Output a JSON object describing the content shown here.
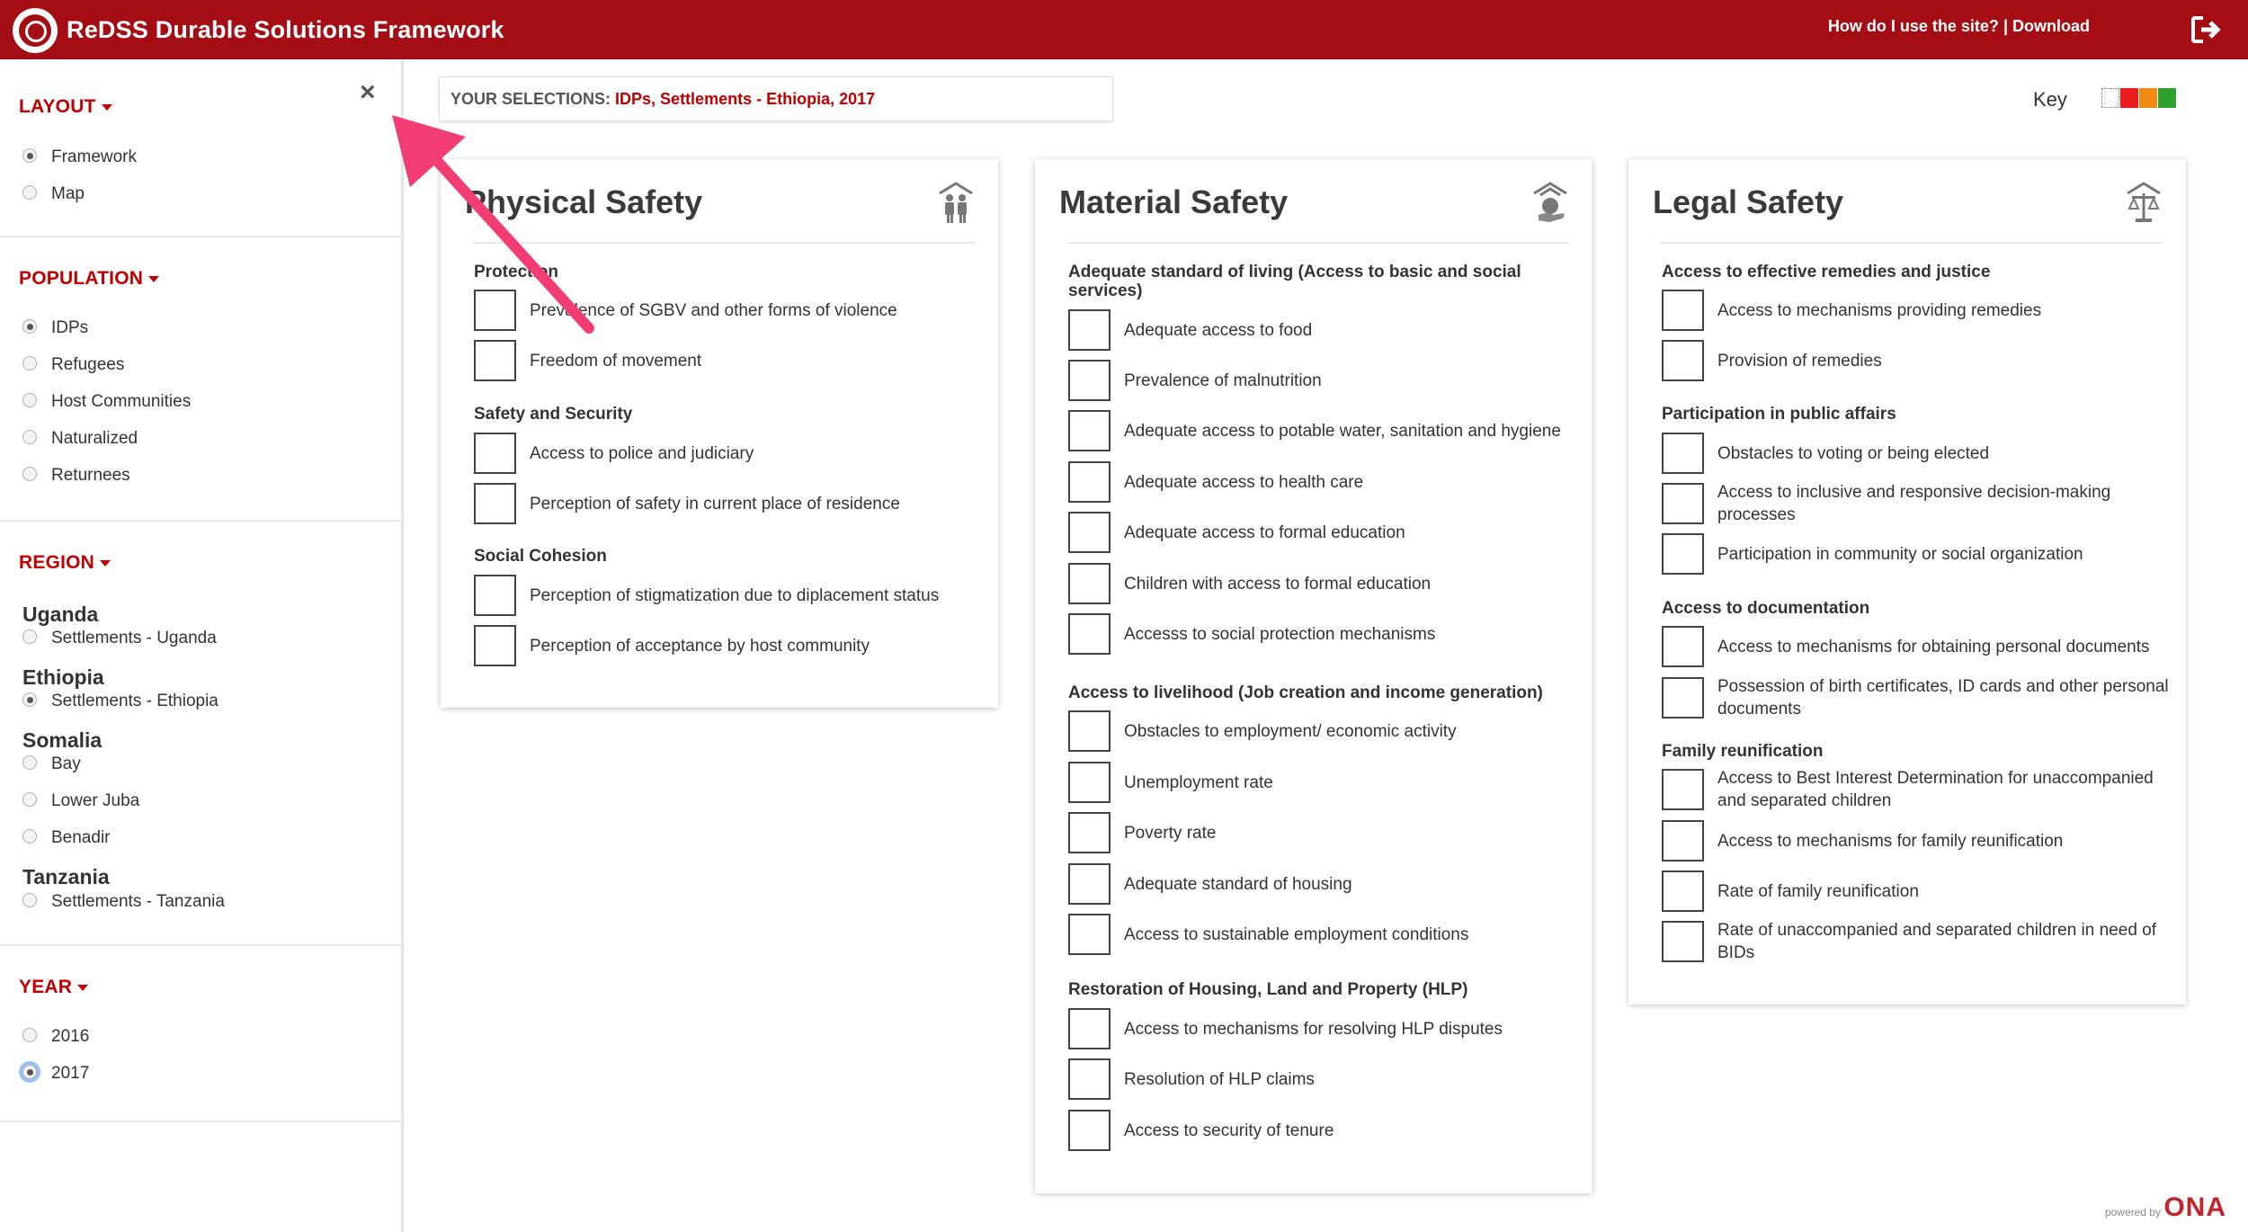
{
  "header": {
    "title": "ReDSS Durable Solutions Framework",
    "help_link": "How do I use the site?",
    "separator": "|",
    "download_link": "Download",
    "logout_icon": "logout-icon"
  },
  "sidebar": {
    "close_icon": "×",
    "layout": {
      "title": "LAYOUT",
      "options": [
        {
          "label": "Framework",
          "selected": true
        },
        {
          "label": "Map",
          "selected": false
        }
      ]
    },
    "population": {
      "title": "POPULATION",
      "options": [
        {
          "label": "IDPs",
          "selected": true
        },
        {
          "label": "Refugees",
          "selected": false
        },
        {
          "label": "Host Communities",
          "selected": false
        },
        {
          "label": "Naturalized",
          "selected": false
        },
        {
          "label": "Returnees",
          "selected": false
        }
      ]
    },
    "region": {
      "title": "REGION",
      "groups": [
        {
          "name": "Uganda",
          "options": [
            {
              "label": "Settlements - Uganda",
              "selected": false
            }
          ]
        },
        {
          "name": "Ethiopia",
          "options": [
            {
              "label": "Settlements - Ethiopia",
              "selected": true
            }
          ]
        },
        {
          "name": "Somalia",
          "options": [
            {
              "label": "Bay",
              "selected": false
            },
            {
              "label": "Lower Juba",
              "selected": false
            },
            {
              "label": "Benadir",
              "selected": false
            }
          ]
        },
        {
          "name": "Tanzania",
          "options": [
            {
              "label": "Settlements - Tanzania",
              "selected": false
            }
          ]
        }
      ]
    },
    "year": {
      "title": "YEAR",
      "options": [
        {
          "label": "2016",
          "selected": false
        },
        {
          "label": "2017",
          "selected": true
        }
      ]
    }
  },
  "selections": {
    "label": "YOUR SELECTIONS:",
    "value": "IDPs, Settlements - Ethiopia, 2017"
  },
  "key": {
    "label": "Key",
    "colors": [
      "#ffffff",
      "#e81c1c",
      "#f08a10",
      "#2ea12e"
    ]
  },
  "cards": [
    {
      "title": "Physical Safety",
      "icon": "family-icon",
      "groups": [
        {
          "name": "Protection",
          "items": [
            "Prevalence of SGBV and other forms of violence",
            "Freedom of movement"
          ]
        },
        {
          "name": "Safety and Security",
          "items": [
            "Access to police and judiciary",
            "Perception of safety in current place of residence"
          ]
        },
        {
          "name": "Social Cohesion",
          "items": [
            "Perception of stigmatization due to diplacement status",
            "Perception of acceptance by host community"
          ]
        }
      ]
    },
    {
      "title": "Material Safety",
      "icon": "shelter-hand-icon",
      "groups": [
        {
          "name": "Adequate standard of living (Access to basic and social services)",
          "items": [
            "Adequate access to food",
            "Prevalence of malnutrition",
            "Adequate access to potable water, sanitation and hygiene",
            "Adequate access to health care",
            "Adequate access to formal education",
            "Children with access to formal education",
            "Accesss to social protection mechanisms"
          ]
        },
        {
          "name": "Access to livelihood (Job creation and income generation)",
          "items": [
            "Obstacles to employment/ economic activity",
            "Unemployment rate",
            "Poverty rate",
            "Adequate standard of housing",
            "Access to sustainable employment conditions"
          ]
        },
        {
          "name": "Restoration of Housing, Land and Property (HLP)",
          "items": [
            "Access to mechanisms for resolving HLP disputes",
            "Resolution of HLP claims",
            "Access to security of tenure"
          ]
        }
      ]
    },
    {
      "title": "Legal Safety",
      "icon": "scales-icon",
      "groups": [
        {
          "name": "Access to effective remedies and justice",
          "items": [
            "Access to mechanisms providing remedies",
            "Provision of remedies"
          ]
        },
        {
          "name": "Participation in public affairs",
          "items": [
            "Obstacles to voting or being elected",
            "Access to inclusive and responsive decision-making processes",
            "Participation in community or social organization"
          ]
        },
        {
          "name": "Access to documentation",
          "items": [
            "Access to mechanisms for obtaining personal documents",
            "Possession of birth certificates, ID cards and other personal documents"
          ]
        },
        {
          "name": "Family reunification",
          "items": [
            "Access to Best Interest Determination for unaccompanied and separated children",
            "Access to mechanisms for family reunification",
            "Rate of family reunification",
            "Rate of unaccompanied and separated children in need of BIDs"
          ]
        }
      ]
    }
  ],
  "footer": {
    "powered_by": "powered by",
    "brand": "ONA"
  }
}
